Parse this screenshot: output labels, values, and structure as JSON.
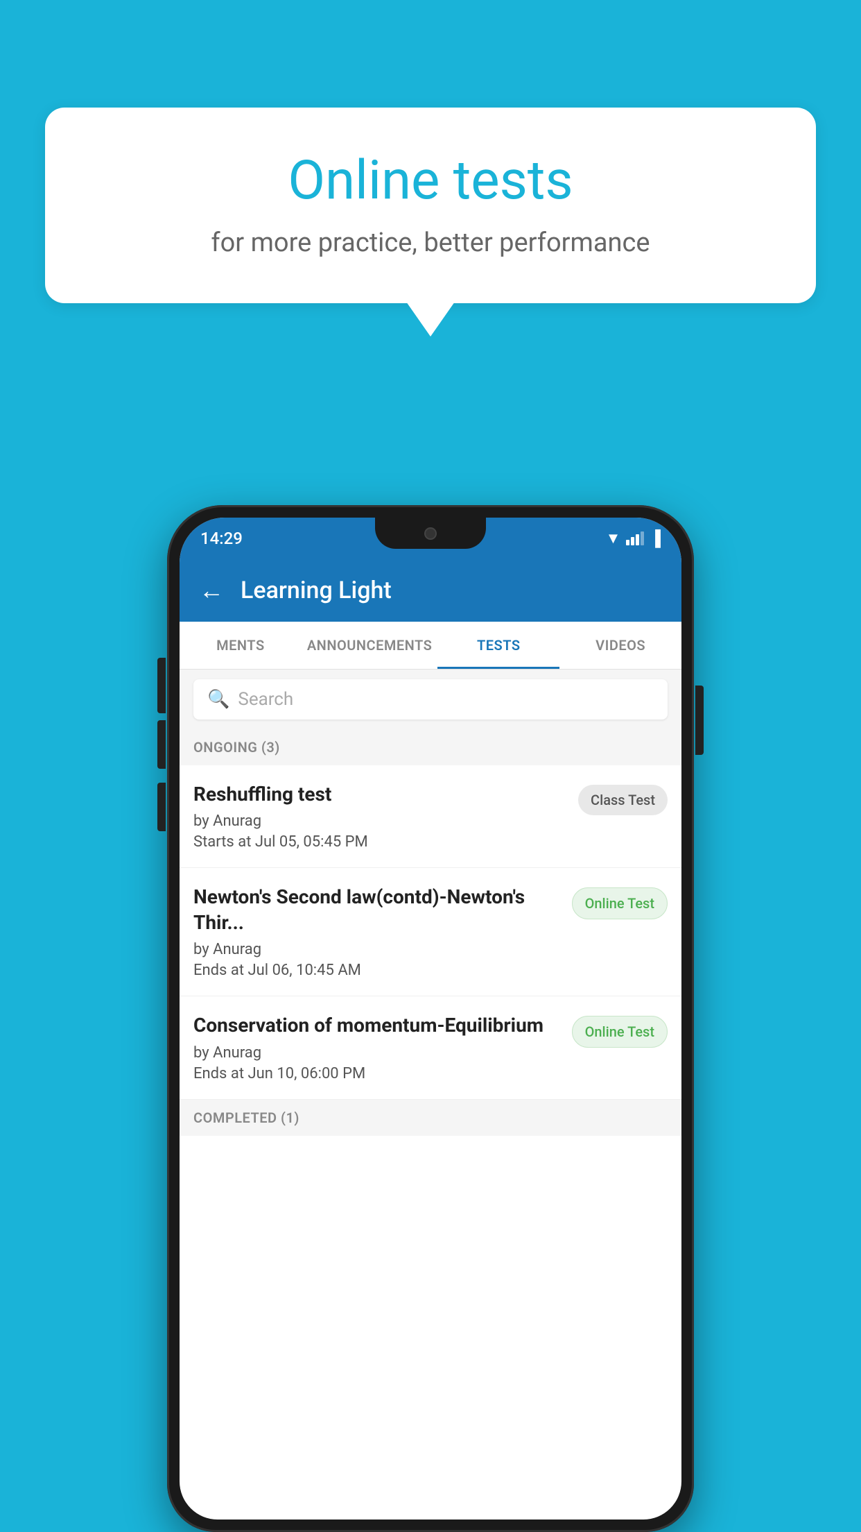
{
  "background_color": "#1ab3d8",
  "speech_bubble": {
    "title": "Online tests",
    "subtitle": "for more practice, better performance"
  },
  "phone": {
    "status_bar": {
      "time": "14:29"
    },
    "header": {
      "title": "Learning Light",
      "back_label": "←"
    },
    "tabs": [
      {
        "label": "MENTS",
        "active": false
      },
      {
        "label": "ANNOUNCEMENTS",
        "active": false
      },
      {
        "label": "TESTS",
        "active": true
      },
      {
        "label": "VIDEOS",
        "active": false
      }
    ],
    "search": {
      "placeholder": "Search"
    },
    "ongoing_section": {
      "label": "ONGOING (3)"
    },
    "tests": [
      {
        "name": "Reshuffling test",
        "author": "by Anurag",
        "date": "Starts at  Jul 05, 05:45 PM",
        "badge": "Class Test",
        "badge_type": "class"
      },
      {
        "name": "Newton's Second law(contd)-Newton's Thir...",
        "author": "by Anurag",
        "date": "Ends at  Jul 06, 10:45 AM",
        "badge": "Online Test",
        "badge_type": "online"
      },
      {
        "name": "Conservation of momentum-Equilibrium",
        "author": "by Anurag",
        "date": "Ends at  Jun 10, 06:00 PM",
        "badge": "Online Test",
        "badge_type": "online"
      }
    ],
    "completed_section": {
      "label": "COMPLETED (1)"
    }
  }
}
